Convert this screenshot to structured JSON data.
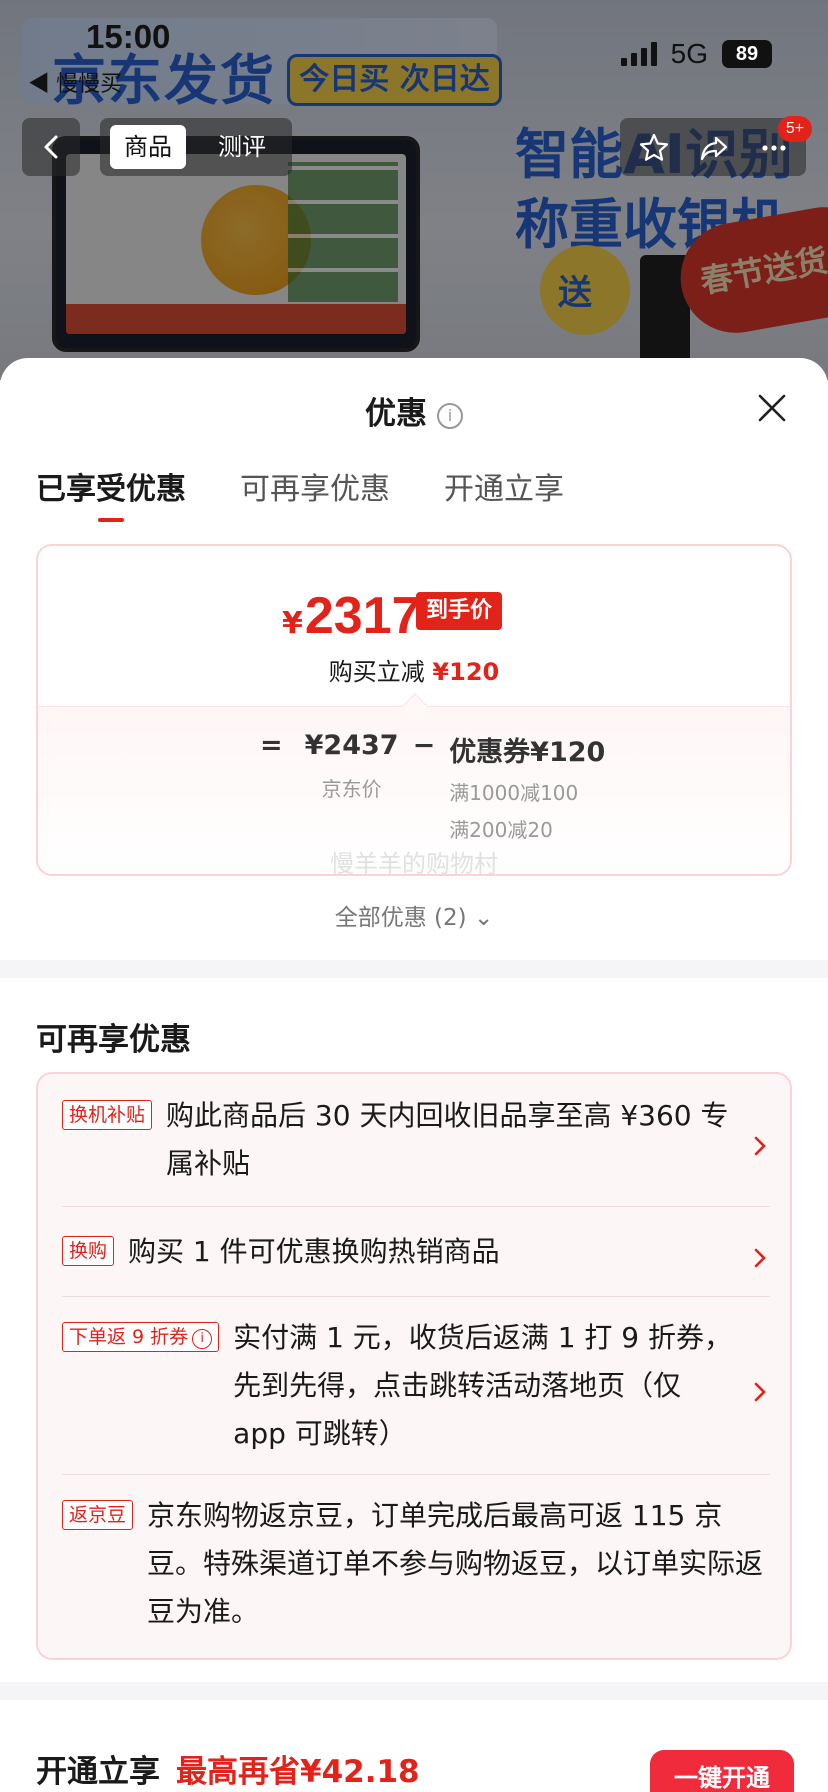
{
  "status_bar": {
    "time": "15:00",
    "back_app": "◀ 慢慢买",
    "network": "5G",
    "battery": "89"
  },
  "background": {
    "banner_text": "京东发货",
    "banner_pill": "今日买 次日达",
    "headline_line1": "智能AI识别",
    "headline_line2": "称重收银机",
    "ribbon_text": "春节送货",
    "gift_text": "送"
  },
  "product_nav": {
    "tab_active": "商品",
    "tab_inactive": "测评",
    "cart_badge": "5+"
  },
  "sheet": {
    "title": "优惠",
    "info_glyph": "i",
    "tabs": [
      "已享受优惠",
      "可再享优惠",
      "开通立享"
    ],
    "price_card": {
      "currency": "¥",
      "final_price": "2317",
      "final_tag": "到手价",
      "reduce_label": "购买立减 ",
      "reduce_value": "¥120",
      "eq": "=",
      "jd_price": "¥2437",
      "jd_price_label": "京东价",
      "minus": "−",
      "coupon": "优惠券¥120",
      "coupon_rule1": "满1000减100",
      "coupon_rule2": "满200减20",
      "watermark": "慢羊羊的购物村"
    },
    "all_offers": "全部优惠 (2) ⌄",
    "more_section": {
      "title": "可再享优惠",
      "offers": [
        {
          "tag": "换机补贴",
          "text": "购此商品后 30 天内回收旧品享至高 ¥360 专属补贴"
        },
        {
          "tag": "换购",
          "text": "购买 1 件可优惠换购热销商品"
        },
        {
          "tag": "下单返 9 折券",
          "text": "实付满 1 元，收货后返满 1 打 9 折券，先到先得，点击跳转活动落地页（仅 app 可跳转）"
        },
        {
          "tag": "返京豆",
          "text": "京东购物返京豆，订单完成后最高可返 115 京豆。特殊渠道订单不参与购物返豆，以订单实际返豆为准。"
        }
      ]
    },
    "bottom": {
      "title": "开通立享",
      "highlight": "最高再省¥42.18",
      "button": "一键开通"
    }
  },
  "colors": {
    "accent_red": "#e2231a",
    "card_border": "#fbd3d6"
  }
}
